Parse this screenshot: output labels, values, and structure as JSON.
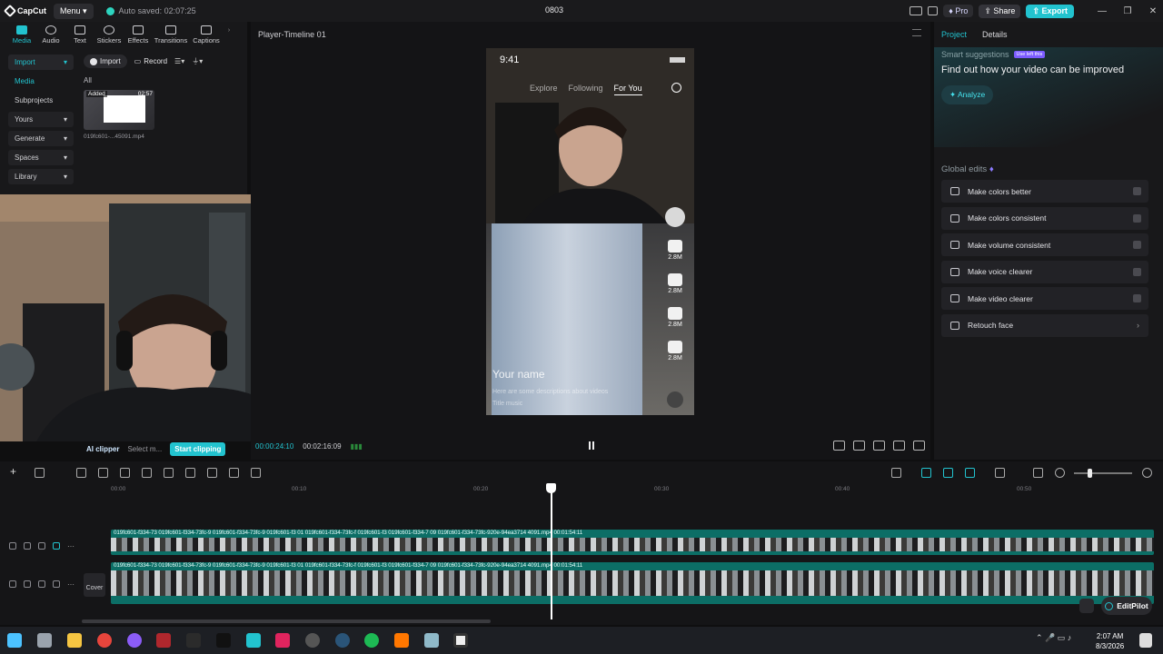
{
  "titlebar": {
    "app_name": "CapCut",
    "menu_label": "Menu",
    "autosave": "Auto saved: 02:07:25",
    "project_title": "0803",
    "pro_label": "Pro",
    "share_label": "Share",
    "export_label": "Export"
  },
  "left_panel": {
    "tabs": [
      {
        "label": "Media"
      },
      {
        "label": "Audio"
      },
      {
        "label": "Text"
      },
      {
        "label": "Stickers"
      },
      {
        "label": "Effects"
      },
      {
        "label": "Transitions"
      },
      {
        "label": "Captions"
      }
    ],
    "nav": {
      "import": "Import",
      "media": "Media",
      "subprojects": "Subprojects",
      "yours": "Yours",
      "generate": "Generate",
      "spaces": "Spaces",
      "library": "Library"
    },
    "toolbar": {
      "import_btn": "Import",
      "record_btn": "Record"
    },
    "filter_label": "All",
    "thumb": {
      "added": "Added",
      "duration": "02:57",
      "filename": "019fc601-...45091.mp4"
    }
  },
  "player": {
    "title": "Player-Timeline 01",
    "phone": {
      "time": "9:41",
      "tab_explore": "Explore",
      "tab_following": "Following",
      "tab_foryou": "For You",
      "likes": "2.8M",
      "comments": "2.8M",
      "saves": "2.8M",
      "shares": "2.8M",
      "name": "Your name",
      "desc": "Here are some descriptions about videos",
      "sound": "Title music"
    },
    "ai_clipper": "AI clipper",
    "select_media": "Select m...",
    "start_clipping": "Start clipping",
    "current_time": "00:00:24:10",
    "total_time": "00:02:16:09"
  },
  "right_panel": {
    "tab_project": "Project",
    "tab_details": "Details",
    "smart_title": "Smart suggestions",
    "smart_badge": "Use left this",
    "smart_sub": "Find out how your video can be improved",
    "analyze": "Analyze",
    "global_title": "Global edits",
    "edits": [
      {
        "label": "Make colors better"
      },
      {
        "label": "Make colors consistent"
      },
      {
        "label": "Make volume consistent"
      },
      {
        "label": "Make voice clearer"
      },
      {
        "label": "Make video clearer"
      },
      {
        "label": "Retouch face"
      }
    ]
  },
  "timeline": {
    "ruler": [
      "00:00",
      "00:10",
      "00:20",
      "00:30",
      "00:40",
      "00:50"
    ],
    "track1_label": "019fc601-f334-73  019fc601-f334-73fc-9  019fc601-f334-73fc-9  019fc601-f3  01  019fc601-f334-73fc-f  019fc601-f3  019fc601-f334-7  09  019fc601-f334-73fc-920e-94ea3714 4091.mp4  00:01:54:11",
    "track2_label": "019fc601-f334-73  019fc601-f334-73fc-9  019fc601-f334-73fc-9  019fc601-f3  01  019fc601-f334-73fc-f  019fc601-f3  019fc601-f334-7  09  019fc601-f334-73fc-920e-94ea3714 4091.mp4  00:01:54:11",
    "cover_label": "Cover",
    "editpilot": "EditPilot"
  },
  "taskbar": {
    "time": "2:07 AM",
    "date": "8/3/2026"
  },
  "colors": {
    "accent": "#22c3cf",
    "track": "#0c6e66"
  }
}
